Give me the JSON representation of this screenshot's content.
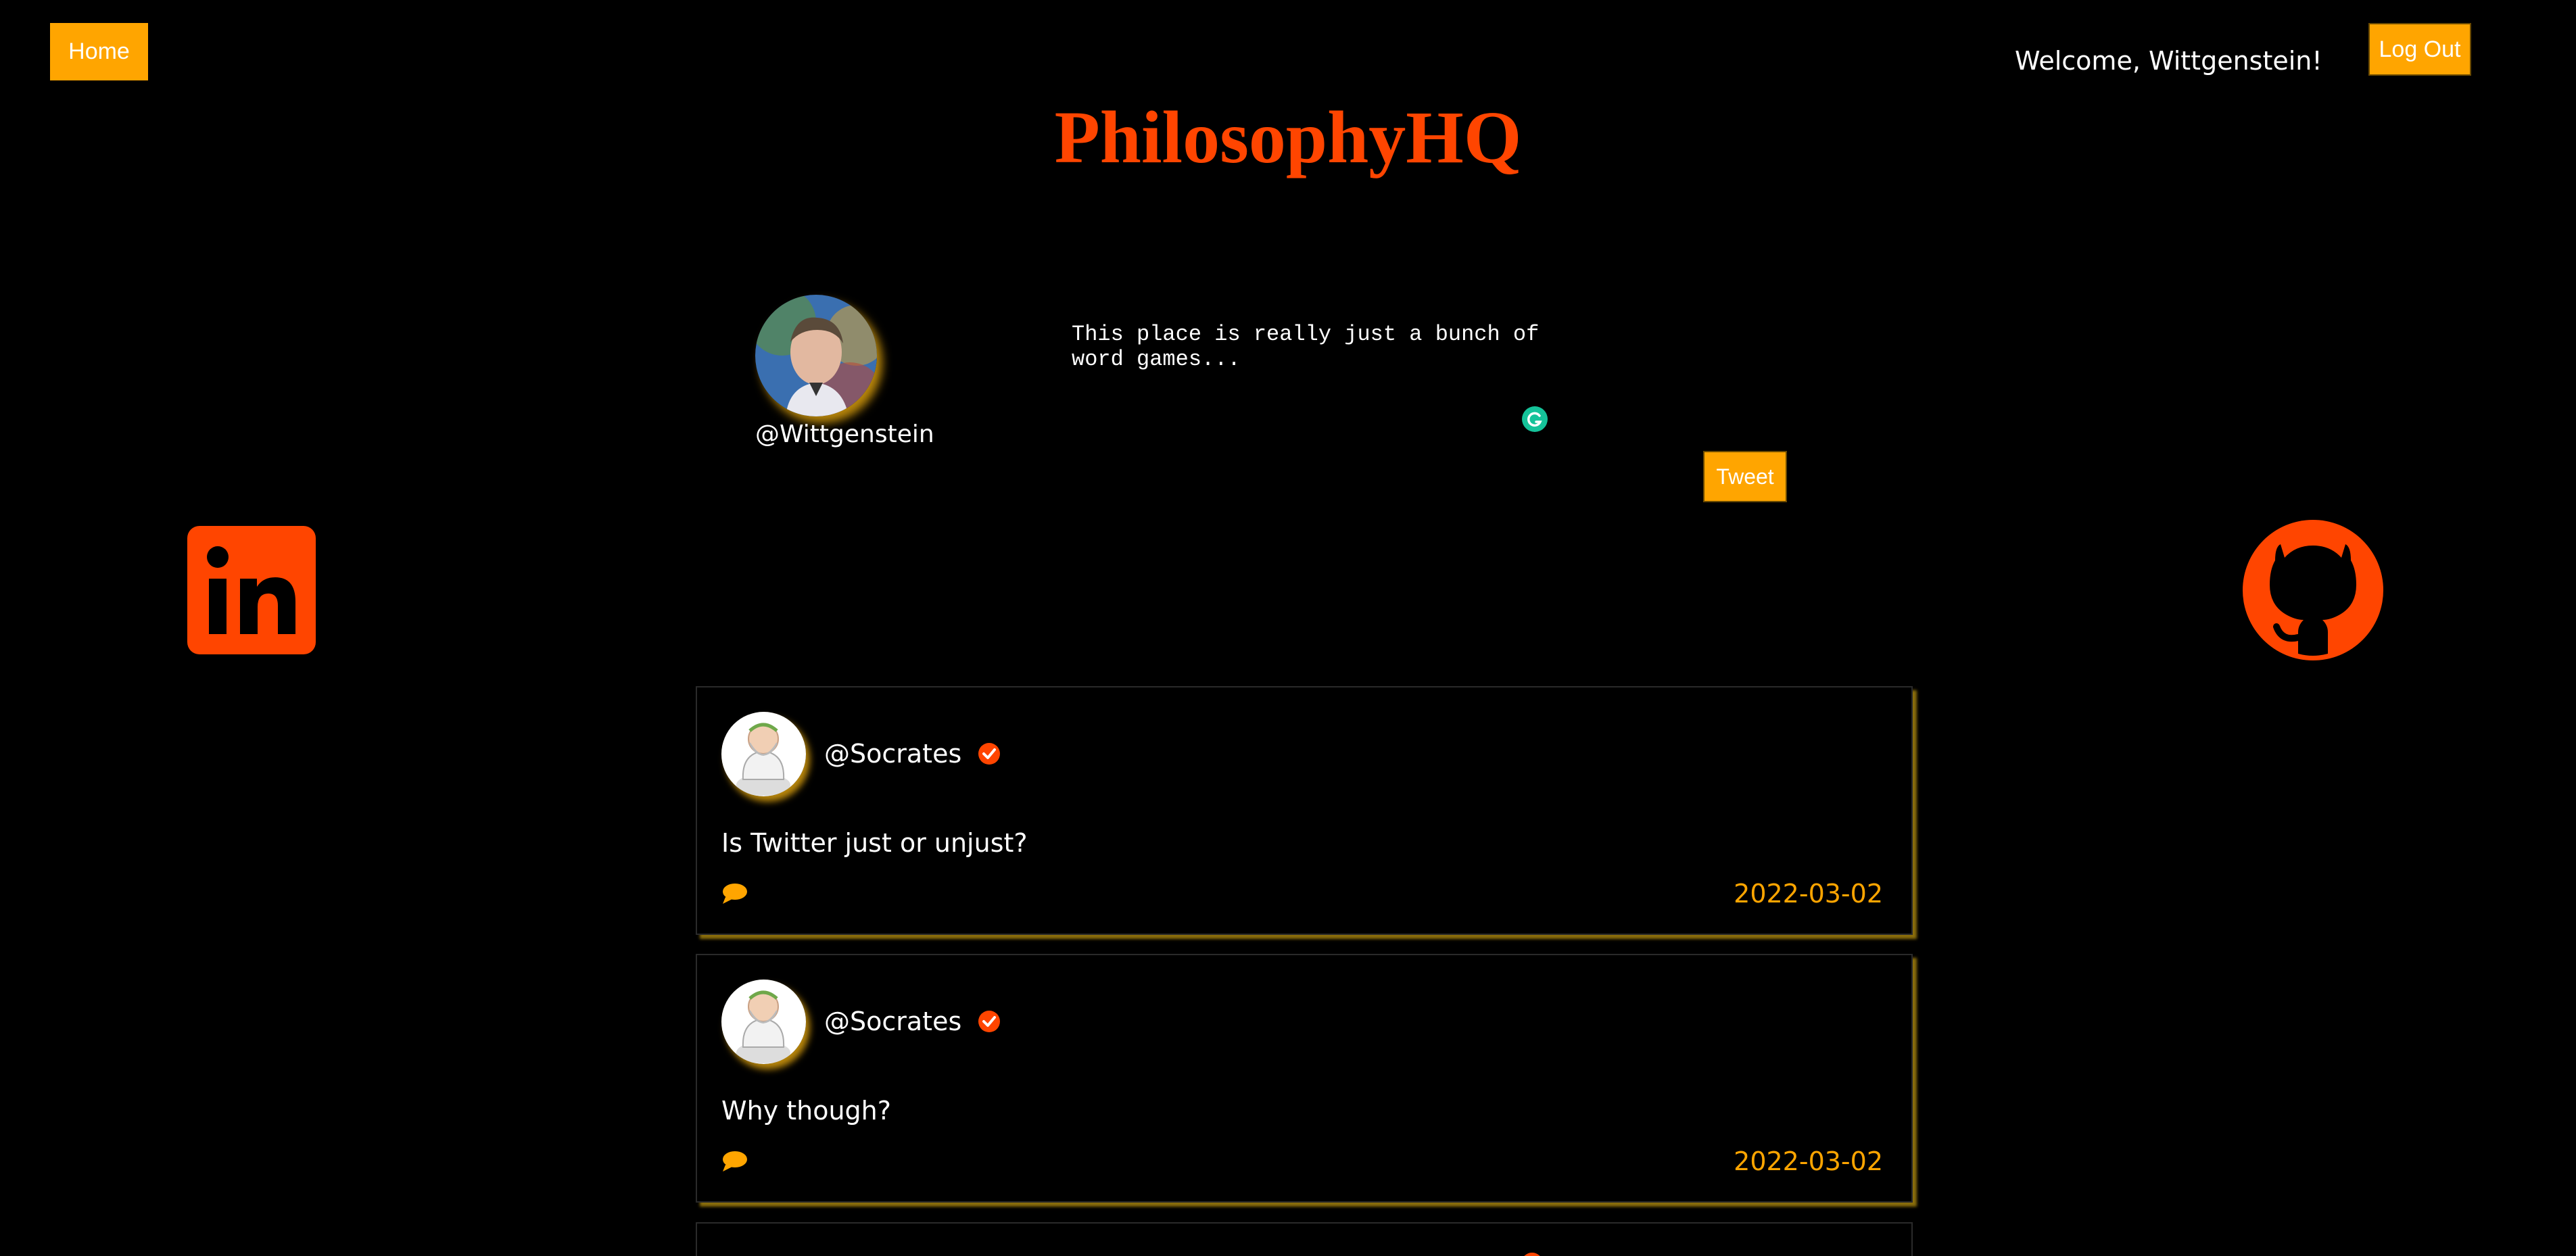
{
  "nav": {
    "home_label": "Home",
    "logout_label": "Log Out",
    "welcome_text": "Welcome, Wittgenstein!"
  },
  "site": {
    "title": "PhilosophyHQ"
  },
  "composer": {
    "handle": "@Wittgenstein",
    "text": "This place is really just a bunch of word games...",
    "tweet_label": "Tweet",
    "avatar_icon": "portrait-avatar"
  },
  "social": {
    "linkedin_icon": "linkedin-icon",
    "github_icon": "github-icon"
  },
  "colors": {
    "accent": "#ffa500",
    "brand": "#ff4500",
    "background": "#000000"
  },
  "feed": {
    "posts": [
      {
        "handle": "@Socrates",
        "text": "Is Twitter just or unjust?",
        "date": "2022-03-02",
        "verified": true
      },
      {
        "handle": "@Socrates",
        "text": "Why though?",
        "date": "2022-03-02",
        "verified": true
      }
    ]
  }
}
